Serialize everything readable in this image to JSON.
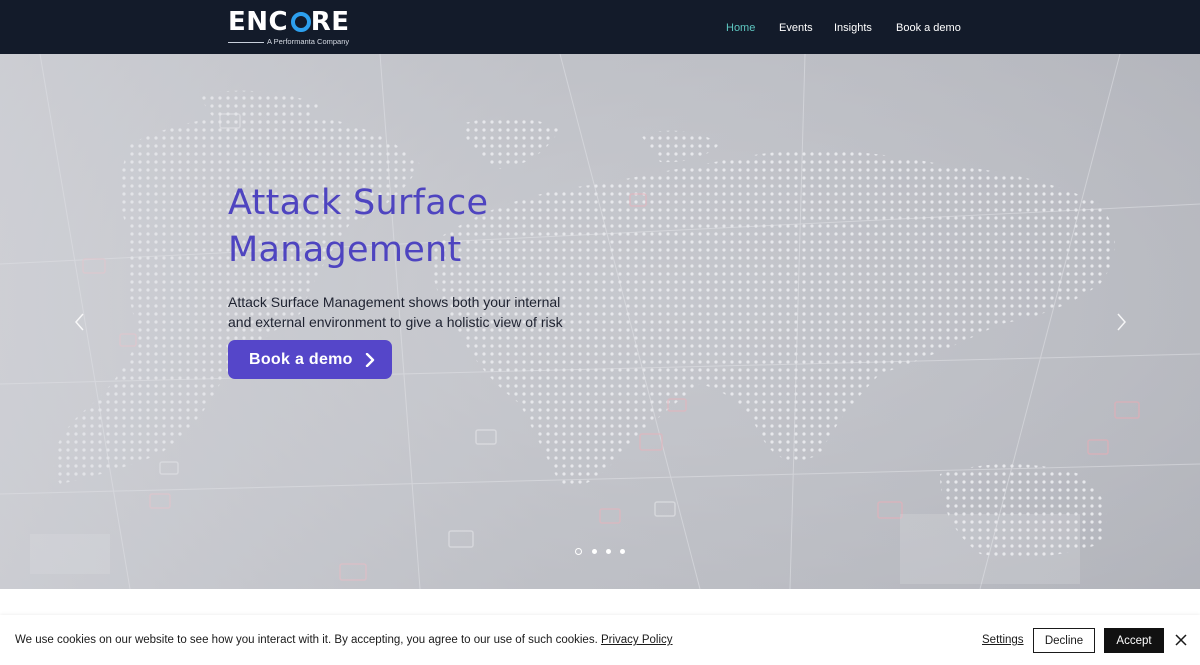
{
  "header": {
    "logo": {
      "wordmark_left": "ENC",
      "wordmark_o": "O",
      "wordmark_right": "RE",
      "tagline": "A Performanta Company"
    },
    "nav": [
      {
        "label": "Home",
        "active": true
      },
      {
        "label": "Events",
        "active": false
      },
      {
        "label": "Insights",
        "active": false
      },
      {
        "label": "Book a demo",
        "active": false
      }
    ]
  },
  "hero": {
    "title_line1": "Attack Surface",
    "title_line2": "Management",
    "description_line1": "Attack Surface Management shows both your internal",
    "description_line2": "and external environment to give a holistic view of risk",
    "cta_label": "Book a demo",
    "cta_icon": "chevron-right-icon",
    "prev_icon": "chevron-left-icon",
    "next_icon": "chevron-right-icon",
    "slides_count": 4,
    "active_slide": 1
  },
  "cookie": {
    "message": "We use cookies on our website to see how you interact with it. By accepting, you agree to our use of such cookies.",
    "policy_link": "Privacy Policy",
    "settings_label": "Settings",
    "decline_label": "Decline",
    "accept_label": "Accept",
    "close_icon": "close-icon"
  },
  "colors": {
    "header_bg": "#131b2a",
    "nav_active": "#5ec7c1",
    "brand_purple": "#5546c9",
    "title_purple": "#4e44c0",
    "logo_accent": "#2da0ee"
  }
}
